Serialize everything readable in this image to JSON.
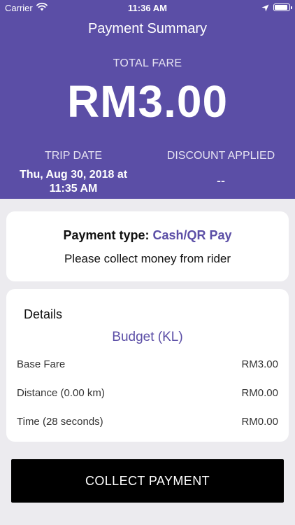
{
  "status_bar": {
    "carrier": "Carrier",
    "time": "11:36 AM",
    "icons": [
      "wifi-icon",
      "location-arrow-icon",
      "battery-icon"
    ]
  },
  "header": {
    "title": "Payment Summary",
    "total_fare_label": "TOTAL FARE",
    "total_fare_amount": "RM3.00",
    "trip_date_label": "TRIP DATE",
    "trip_date_value_line1": "Thu, Aug 30, 2018 at",
    "trip_date_value_line2": "11:35 AM",
    "discount_label": "DISCOUNT APPLIED",
    "discount_value": "--"
  },
  "payment": {
    "type_label": "Payment type:",
    "type_value": "Cash/QR Pay",
    "message": "Please collect money from rider"
  },
  "details": {
    "heading": "Details",
    "package": "Budget (KL)",
    "rows": [
      {
        "label": "Base Fare",
        "value": "RM3.00"
      },
      {
        "label": "Distance (0.00 km)",
        "value": "RM0.00"
      },
      {
        "label": "Time (28 seconds)",
        "value": "RM0.00"
      }
    ]
  },
  "actions": {
    "collect_payment": "COLLECT PAYMENT"
  },
  "colors": {
    "header_purple": "#5b4ea6",
    "accent_purple": "#5b4ea6",
    "page_background": "#ecebef",
    "button_black": "#000000"
  }
}
